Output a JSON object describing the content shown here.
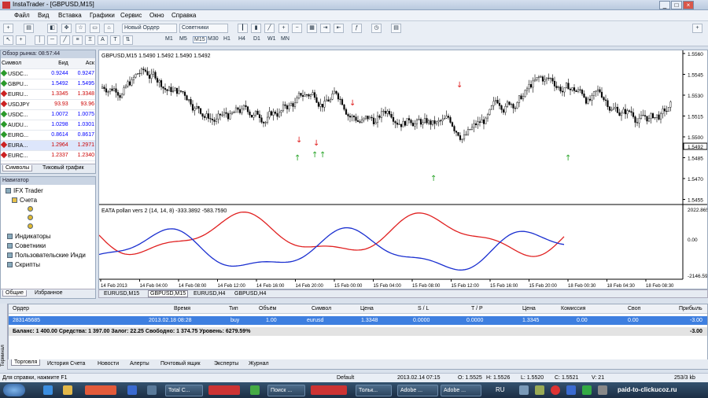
{
  "window": {
    "title": "InstaTrader - [GBPUSD,M15]"
  },
  "menu": [
    "Файл",
    "Вид",
    "Вставка",
    "Графики",
    "Сервис",
    "Окно",
    "Справка"
  ],
  "toolbar": {
    "new_order": "Новый Ордер",
    "advisors": "Советники",
    "timeframes": [
      "M1",
      "M5",
      "M15",
      "M30",
      "H1",
      "H4",
      "D1",
      "W1",
      "MN"
    ],
    "active_tf": "M15"
  },
  "market_watch": {
    "title": "Обзор рынка: 08:57:44",
    "col_symbol": "Символ",
    "col_bid": "Бид",
    "col_ask": "Аск",
    "rows": [
      {
        "sym": "USDC...",
        "bid": "0.9244",
        "ask": "0.9247",
        "dir": "up"
      },
      {
        "sym": "GBPU...",
        "bid": "1.5492",
        "ask": "1.5495",
        "dir": "up"
      },
      {
        "sym": "EURU...",
        "bid": "1.3345",
        "ask": "1.3348",
        "dir": "down"
      },
      {
        "sym": "USDJPY",
        "bid": "93.93",
        "ask": "93.96",
        "dir": "down"
      },
      {
        "sym": "USDC...",
        "bid": "1.0072",
        "ask": "1.0075",
        "dir": "up"
      },
      {
        "sym": "AUDU...",
        "bid": "1.0298",
        "ask": "1.0301",
        "dir": "up"
      },
      {
        "sym": "EURG...",
        "bid": "0.8614",
        "ask": "0.8617",
        "dir": "up"
      },
      {
        "sym": "EURA...",
        "bid": "1.2964",
        "ask": "1.2971",
        "dir": "down"
      },
      {
        "sym": "EURC...",
        "bid": "1.2337",
        "ask": "1.2340",
        "dir": "down"
      }
    ],
    "tab_symbols": "Символы",
    "tab_tick": "Тиковый график"
  },
  "navigator": {
    "title": "Навигатор",
    "root": "IFX Trader",
    "accounts": "Счета",
    "indicators": "Индикаторы",
    "advisors": "Советники",
    "custom": "Пользовательские Инди",
    "scripts": "Скрипты",
    "tab_common": "Общие",
    "tab_fav": "Избранное"
  },
  "chart": {
    "header": "GBPUSD,M15  1.5490 1.5492 1.5490 1.5492",
    "indicator": "EATA pollan vers 2 (14, 14, 8) -333.3892 -583.7590",
    "price_ticks": [
      "1.5560",
      "1.5545",
      "1.5530",
      "1.5515",
      "1.5500",
      "1.5485",
      "1.5470",
      "1.5455"
    ],
    "current_price": "1.5492",
    "ind_ticks": [
      "2022.865",
      "0.00",
      "-2146.59"
    ],
    "time_labels": [
      "14 Feb 2013",
      "14 Feb 04:00",
      "14 Feb 08:00",
      "14 Feb 12:00",
      "14 Feb 16:00",
      "14 Feb 20:00",
      "15 Feb 00:00",
      "15 Feb 04:00",
      "15 Feb 08:00",
      "15 Feb 12:00",
      "15 Feb 16:00",
      "15 Feb 20:00",
      "18 Feb 00:30",
      "18 Feb 04:30",
      "18 Feb 08:30"
    ],
    "tabs": [
      "EURUSD,M15",
      "GBPUSD,M15",
      "EURUSD,H4",
      "GBPUSD,H4"
    ],
    "active_tab": "GBPUSD,M15",
    "colors": {
      "red": "#e02020",
      "blue": "#1a2fd0",
      "candle": "#000000"
    }
  },
  "terminal": {
    "side_label": "Терминал",
    "headers": [
      "Ордер",
      "Время",
      "Тип",
      "Объём",
      "Символ",
      "Цена",
      "S / L",
      "T / P",
      "Цена",
      "Комиссия",
      "Своп",
      "Прибыль"
    ],
    "order": [
      "283145685",
      "2013.02.18 08:28",
      "buy",
      "1.00",
      "eurusd",
      "1.3348",
      "0.0000",
      "0.0000",
      "1.3345",
      "0.00",
      "0.00",
      "-3.00"
    ],
    "balance": "Баланс: 1 400.00  Средства: 1 397.00  Залог: 22.25  Свободно: 1 374.75  Уровень: 6279.59%",
    "balance_profit": "-3.00",
    "tabs": [
      "Торговля",
      "История Счета",
      "Новости",
      "Алерты",
      "Почтовый ящик",
      "Эксперты",
      "Журнал"
    ]
  },
  "status": {
    "help": "Для справки, нажмите F1",
    "profile": "Default",
    "time": "2013.02.14 07:15",
    "o": "O: 1.5525",
    "h": "H: 1.5526",
    "l": "L: 1.5520",
    "c": "C: 1.5521",
    "v": "V: 21",
    "traffic": "253/3 kb"
  },
  "taskbar": {
    "items": [
      "Total C...",
      "Поиск ...",
      "Тольк...",
      "Adobe ...",
      "Adobe ..."
    ],
    "lang": "RU",
    "watermark": "paid-to-clickucoz.ru"
  }
}
